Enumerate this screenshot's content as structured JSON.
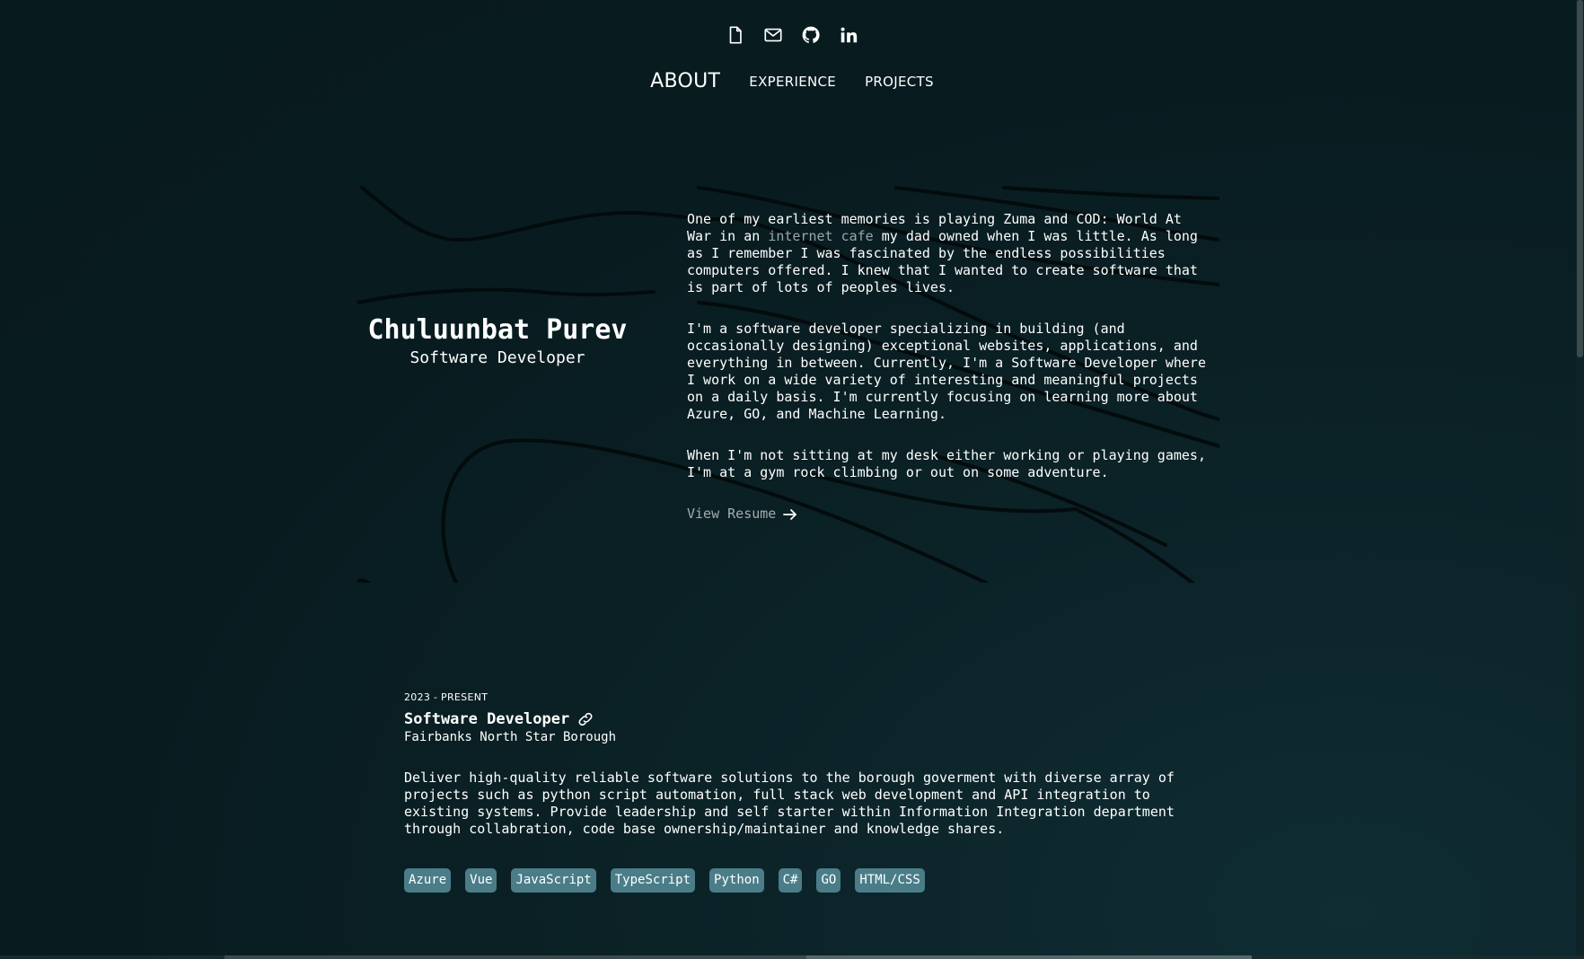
{
  "top_icons": [
    {
      "name": "document-icon"
    },
    {
      "name": "mail-icon"
    },
    {
      "name": "github-icon"
    },
    {
      "name": "linkedin-icon"
    }
  ],
  "nav": {
    "about": "ABOUT",
    "experience": "EXPERIENCE",
    "projects": "PROJECTS"
  },
  "hero": {
    "name": "Chuluunbat Purev",
    "role": "Software Developer"
  },
  "bio": {
    "p1_before": "One of my earliest memories is playing Zuma and COD: World At War in an ",
    "p1_link": "internet cafe",
    "p1_after": " my dad owned when I was little. As long as I remember I was fascinated by the endless possibilities computers offered. I knew that I wanted to create software that is part of lots of peoples lives.",
    "p2": "I'm a software developer specializing in building (and occasionally designing) exceptional websites, applications, and everything in between. Currently, I'm a Software Developer where I work on a wide variety of interesting and meaningful projects on a daily basis. I'm currently focusing on learning more about Azure, GO, and Machine Learning.",
    "p3": "When I'm not sitting at my desk either working or playing games, I'm at a gym rock climbing or out on some adventure.",
    "view_resume": "View Resume"
  },
  "experience": {
    "date": "2023 - PRESENT",
    "title": "Software Developer",
    "org": "Fairbanks North Star Borough",
    "description": "Deliver high-quality reliable software solutions to the borough goverment with diverse array of projects such as python script automation, full stack web development and API integration to existing systems. Provide leadership and self starter within Information Integration department through collabration, code base ownership/maintainer and knowledge shares.",
    "tags": [
      "Azure",
      "Vue",
      "JavaScript",
      "TypeScript",
      "Python",
      "C#",
      "GO",
      "HTML/CSS"
    ]
  },
  "colors": {
    "background": "#081b1f",
    "tag_bg": "#4a7d88",
    "muted_link": "#9aa7aa"
  }
}
